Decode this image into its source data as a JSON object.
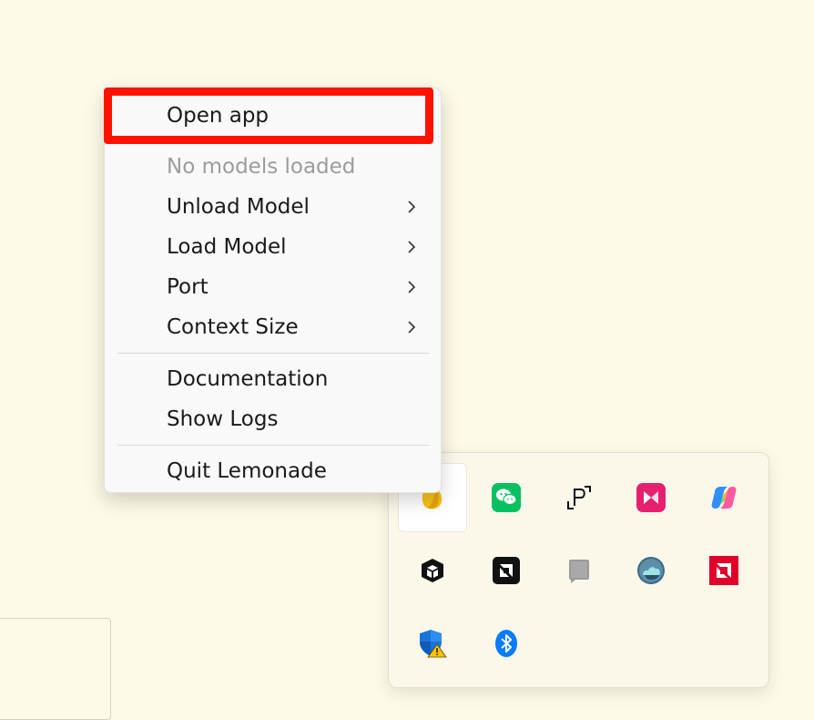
{
  "context_menu": {
    "items": [
      {
        "label": "Open app",
        "disabled": false,
        "submenu": false
      },
      {
        "label": "No models loaded",
        "disabled": true,
        "submenu": false
      },
      {
        "label": "Unload Model",
        "disabled": false,
        "submenu": true
      },
      {
        "label": "Load Model",
        "disabled": false,
        "submenu": true
      },
      {
        "label": "Port",
        "disabled": false,
        "submenu": true
      },
      {
        "label": "Context Size",
        "disabled": false,
        "submenu": true
      },
      {
        "label": "Documentation",
        "disabled": false,
        "submenu": false
      },
      {
        "label": "Show Logs",
        "disabled": false,
        "submenu": false
      },
      {
        "label": "Quit Lemonade",
        "disabled": false,
        "submenu": false
      }
    ],
    "highlight_color": "#ff1300"
  },
  "tray_flyout": {
    "icons": [
      {
        "name": "lemonade-icon",
        "hovered": true
      },
      {
        "name": "wechat-icon"
      },
      {
        "name": "screenshot-p-icon"
      },
      {
        "name": "pink-app-icon"
      },
      {
        "name": "copilot-icon"
      },
      {
        "name": "cube-icon"
      },
      {
        "name": "amd-software-icon"
      },
      {
        "name": "gray-app-icon"
      },
      {
        "name": "cloud-globe-icon"
      },
      {
        "name": "amd-red-icon"
      },
      {
        "name": "security-warning-icon"
      },
      {
        "name": "bluetooth-icon"
      }
    ]
  },
  "colors": {
    "desktop_background": "#fefae8",
    "menu_background": "#f9f9f9",
    "wechat": "#07c160",
    "pink_app": "#e6206e",
    "amd_red": "#e0002a",
    "bluetooth": "#0a7cff"
  }
}
